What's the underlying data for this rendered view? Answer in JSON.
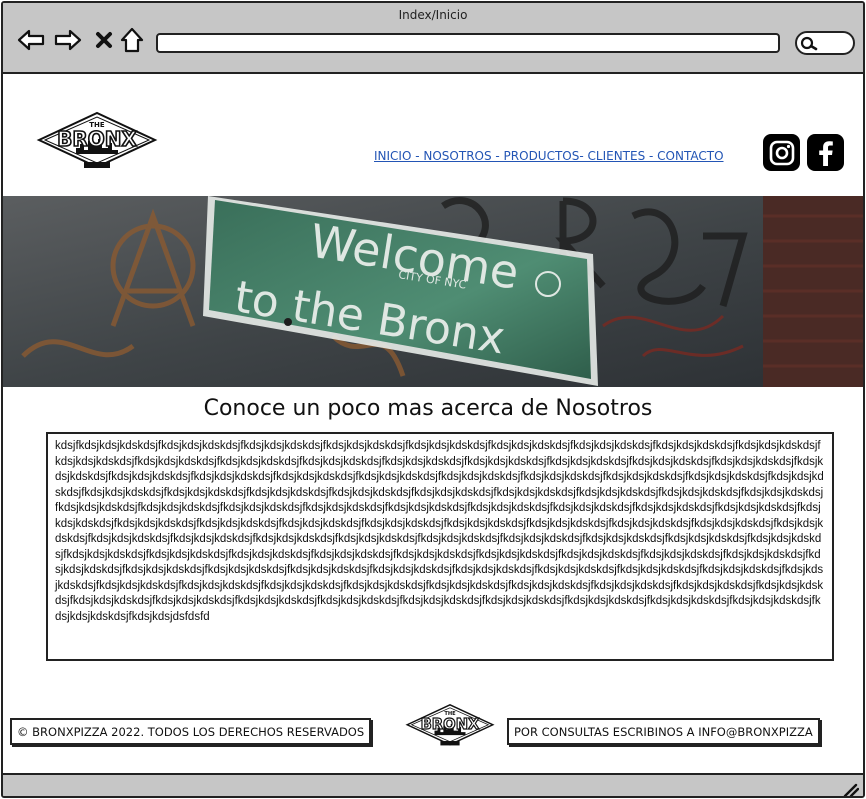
{
  "browser": {
    "title": "Index/Inicio",
    "url": ""
  },
  "header": {
    "logo_text": "THE BRONX",
    "nav_label": "INICIO - NOSOTROS - PRODUCTOS- CLIENTES - CONTACTO",
    "social": [
      "instagram-icon",
      "facebook-icon"
    ]
  },
  "hero": {
    "sign_line1": "Welcome",
    "sign_line2": "CITY OF NYC",
    "sign_line3": "to the Bronx"
  },
  "about": {
    "title": "Conoce un poco mas acerca de Nosotros",
    "body": "kdsjfkdsjkdsjkdskdsjfkdsjkdsjkdskdsjfkdsjkdsjkdskdsjfkdsjkdsjkdskdsjfkdsjkdsjkdskdsjfkdsjkdsjkdskdsjfkdsjkdsjkdskdsjfkdsjkdsjkdskdsjfkdsjkdsjkdskdsjfkdsjkdsjkdskdsjfkdsjkdsjkdskdsjfkdsjkdsjkdskdsjfkdsjkdsjkdskdsjfkdsjkdsjkdskdsjfkdsjkdsjkdskdsjfkdsjkdsjkdskdsjfkdsjkdsjkdskdsjfkdsjkdsjkdskdsjfkdsjkdsjkdskdsjfkdsjkdsjkdskdsjfkdsjkdsjkdskdsjfkdsjkdsjkdskdsjfkdsjkdsjkdskdsjfkdsjkdsjkdskdsjfkdsjkdsjkdskdsjfkdsjkdsjkdskdsjfkdsjkdsjkdskdsjfkdsjkdsjkdskdsjfkdsjkdsjkdskdsjfkdsjkdsjkdskdsjfkdsjkdsjkdskdsjfkdsjkdsjkdskdsjfkdsjkdsjkdskdsjfkdsjkdsjkdskdsjfkdsjkdsjkdskdsjfkdsjkdsjkdskdsjfkdsjkdsjkdskdsjfkdsjkdsjkdskdsjfkdsjkdsjkdskdsjfkdsjkdsjkdskdsjfkdsjkdsjkdskdsjfkdsjkdsjkdskdsjfkdsjkdsjkdskdsjfkdsjkdsjkdskdsjfkdsjkdsjkdskdsjfkdsjkdsjkdskdsjfkdsjkdsjkdskdsjfkdsjkdsjkdskdsjfkdsjkdsjkdskdsjfkdsjkdsjkdskdsjfkdsjkdsjkdskdsjfkdsjkdsjkdskdsjfkdsjkdsjkdskdsjfkdsjkdsjkdskdsjfkdsjkdsjkdskdsjfkdsjkdsjkdskdsjfkdsjkdsjkdskdsjfkdsjkdsjkdskdsjfkdsjkdsjkdskdsjfkdsjkdsjkdskdsjfkdsjkdsjkdskdsjfkdsjkdsjkdskdsjfkdsjkdsjkdskdsjfkdsjkdsjkdskdsjfkdsjkdsjkdskdsjfkdsjkdsjkdskdsjfkdsjkdsjkdskdsjfkdsjkdsjkdskdsjfkdsjkdsjkdskdsjfkdsjkdsjkdskdsjfkdsjkdsjkdskdsjfkdsjkdsjkdskdsjfkdsjkdsjkdskdsjfkdsjkdsjkdskdsjfkdsjkdsjkdskdsjfkdsjkdsjkdskdsjfkdsjkdsjkdskdsjfkdsjkdsjkdskdsjfkdsjkdsjkdskdsjfkdsjkdsjkdskdsjfkdsjkdsjkdskdsjfkdsjkdsjkdskdsjfkdsjkdsjkdskdsjfkdsjkdsjkdskdsjfkdsjkdsjkdskdsjfkdsjkdsjkdskdsjfkdsjkdsjkdskdsjfkdsjkdsjkdskdsjfkdsjkdsjkdskdsjfkdsjkdsjkdskdsjfkdsjkdsjkdskdsjfkdsjkdsjkdskdsjfkdsjkdsjkdskdsjfkdsjkdsjkdskdsjfkdsjkdsjkdskdsjfkdsjkdsjkdskdsjfkdsjkdsjkdskdsjfkdsjkdsjkdskdsjfkdsjkdsjkdskdsjfkdsjkdsjkdskdsjfkdsjkdsjkdskdsjfkdsjkdsjkdskdsjfkdsjkdsjkdskdsjfkdsjkdsjdsfdsfd"
  },
  "footer": {
    "copyright": "© BRONXPIZZA 2022. TODOS LOS DERECHOS RESERVADOS",
    "contact": "POR CONSULTAS ESCRIBINOS A INFO@BRONXPIZZA"
  },
  "colors": {
    "chrome": "#c6c6c6",
    "link": "#2355b5",
    "sign_green": "#3f7d64"
  }
}
